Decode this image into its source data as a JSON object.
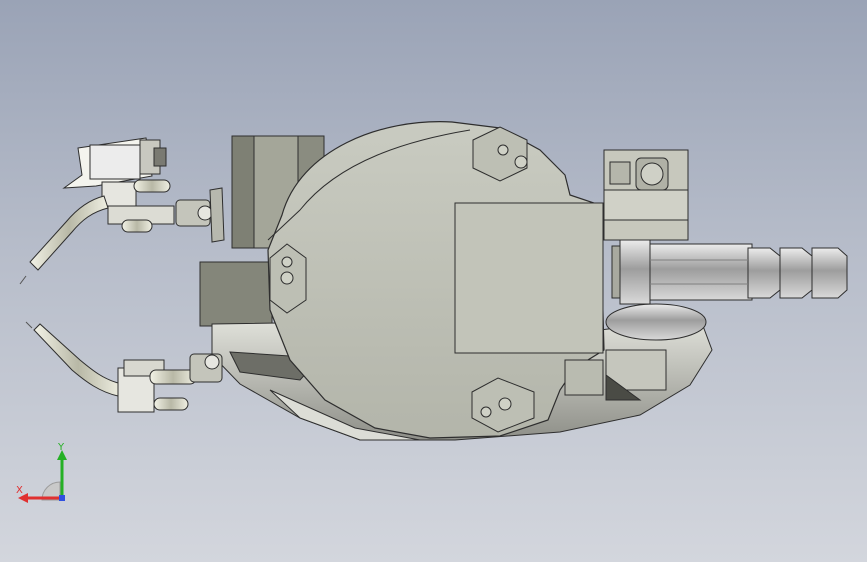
{
  "view": {
    "background_top": "#9aa3b6",
    "background_bottom": "#d3d6dd"
  },
  "triad": {
    "x_label": "X",
    "y_label": "Y",
    "x_color": "#e03030",
    "y_color": "#25b025",
    "z_color": "#3050e0"
  }
}
